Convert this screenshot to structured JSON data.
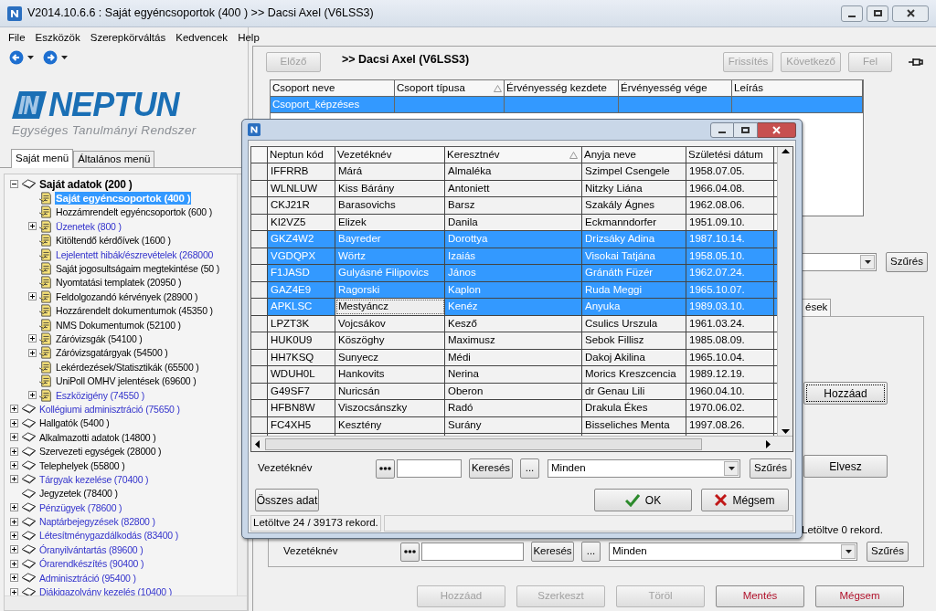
{
  "window": {
    "title": "V2014.10.6.6 : Saját egyéncsoportok (400  )  >> Dacsi Axel (V6LSS3)"
  },
  "menu": [
    "File",
    "Eszközök",
    "Szerepkörváltás",
    "Kedvencek",
    "Help"
  ],
  "logo": {
    "name": "NEPTUN",
    "tagline": "Egységes Tanulmányi Rendszer"
  },
  "left_tabs": [
    {
      "label": "Saját menü",
      "selected": true
    },
    {
      "label": "Általános menü",
      "selected": false
    }
  ],
  "tree": [
    {
      "label": "Saját adatok (200 )",
      "kind": "plain",
      "expanded": true,
      "selected": false,
      "children": [
        {
          "label": "Saját egyéncsoportok (400 )",
          "selected": true
        },
        {
          "label": "Hozzámrendelt egyéncsoportok (600 )",
          "kind": "plain",
          "selected": false
        },
        {
          "label": "Üzenetek (800 )",
          "kind": "link",
          "expanded": false,
          "selected": false
        },
        {
          "label": "Kitöltendő kérdőívek (1600 )",
          "kind": "plain",
          "selected": false
        },
        {
          "label": "Lejelentett hibák/észrevételek (268000",
          "kind": "link",
          "selected": false
        },
        {
          "label": "Saját jogosultságaim megtekintése (50 )",
          "kind": "plain",
          "selected": false
        },
        {
          "label": "Nyomtatási templatek (20950 )",
          "kind": "plain",
          "selected": false
        },
        {
          "label": "Feldolgozandó kérvények (28900 )",
          "kind": "plain",
          "expanded": false,
          "selected": false
        },
        {
          "label": "Hozzárendelt dokumentumok (45350 )",
          "kind": "plain",
          "selected": false
        },
        {
          "label": "NMS Dokumentumok (52100 )",
          "kind": "plain",
          "selected": false
        },
        {
          "label": "Záróvizsgák (54100 )",
          "kind": "plain",
          "expanded": false,
          "selected": false
        },
        {
          "label": "Záróvizsgatárgyak (54500 )",
          "kind": "plain",
          "expanded": false,
          "selected": false
        },
        {
          "label": "Lekérdezések/Statisztikák (65500 )",
          "kind": "plain",
          "selected": false
        },
        {
          "label": "UniPoll OMHV jelentések (69600 )",
          "kind": "plain",
          "selected": false
        },
        {
          "label": "Eszközigény (74550 )",
          "kind": "link",
          "expanded": false,
          "selected": false
        }
      ]
    },
    {
      "label": "Kollégiumi adminisztráció (75650 )",
      "kind": "link",
      "expanded": false,
      "selected": false
    },
    {
      "label": "Hallgatók (5400 )",
      "kind": "plain",
      "expanded": false,
      "selected": false
    },
    {
      "label": "Alkalmazotti adatok (14800 )",
      "kind": "plain",
      "expanded": false,
      "selected": false
    },
    {
      "label": "Szervezeti egységek (28000 )",
      "kind": "plain",
      "expanded": false,
      "selected": false
    },
    {
      "label": "Telephelyek (55800 )",
      "kind": "plain",
      "expanded": false,
      "selected": false
    },
    {
      "label": "Tárgyak kezelése (70400 )",
      "kind": "link",
      "expanded": false,
      "selected": false
    },
    {
      "label": "Jegyzetek (78400 )",
      "kind": "plain",
      "selected": false
    },
    {
      "label": "Pénzügyek (78600 )",
      "kind": "link",
      "expanded": false,
      "selected": false
    },
    {
      "label": "Naptárbejegyzések (82800 )",
      "kind": "link",
      "expanded": false,
      "selected": false
    },
    {
      "label": "Létesítménygazdálkodás (83400 )",
      "kind": "link",
      "expanded": false,
      "selected": false
    },
    {
      "label": "Óranyilvántartás (89600 )",
      "kind": "link",
      "expanded": false,
      "selected": false
    },
    {
      "label": "Órarendkészítés (90400 )",
      "kind": "link",
      "expanded": false,
      "selected": false
    },
    {
      "label": "Adminisztráció (95400 )",
      "kind": "link",
      "expanded": false,
      "selected": false
    },
    {
      "label": "Diákigazolvány kezelés (10400 )",
      "kind": "link",
      "expanded": false,
      "selected": false
    }
  ],
  "record": {
    "prev_button": {
      "label": "Előző",
      "disabled": true
    },
    "title": ">> Dacsi Axel (V6LSS3)",
    "right_buttons": [
      {
        "label": "Frissítés",
        "disabled": true
      },
      {
        "label": "Következő",
        "disabled": true
      },
      {
        "label": "Fel",
        "disabled": true
      }
    ]
  },
  "groups_table": {
    "columns": [
      {
        "label": "Csoport neve",
        "sorted": false
      },
      {
        "label": "Csoport típusa",
        "sorted": true
      },
      {
        "label": "Érvényesség kezdete",
        "sorted": false
      },
      {
        "label": "Érvényesség vége",
        "sorted": false
      },
      {
        "label": "Leírás",
        "sorted": false
      }
    ],
    "rows": [
      {
        "cells": [
          "Csoport_képzéses"
        ],
        "selected": true
      }
    ]
  },
  "upper_filter": {
    "filter_button": "Szűrés"
  },
  "detail_tab": {
    "label": "ések",
    "selected": true
  },
  "side_buttons": [
    {
      "label": "Hozzáad",
      "focused": true
    },
    {
      "label": "Elvesz",
      "focused": false
    }
  ],
  "side_status": "Letöltve 0 rekord.",
  "lower_filter": {
    "label": "Vezetéknév",
    "search_button": "Keresés",
    "more_button": "...",
    "combo": "Minden",
    "filter_button": "Szűrés"
  },
  "bottom_buttons": [
    {
      "label": "Hozzáad",
      "disabled": true,
      "kind": "normal"
    },
    {
      "label": "Szerkeszt",
      "disabled": true,
      "kind": "normal"
    },
    {
      "label": "Töröl",
      "disabled": true,
      "kind": "normal"
    },
    {
      "label": "Mentés",
      "disabled": false,
      "kind": "danger"
    },
    {
      "label": "Mégsem",
      "disabled": false,
      "kind": "danger"
    }
  ],
  "dialog": {
    "columns": [
      {
        "label": "Neptun kód",
        "sorted": false
      },
      {
        "label": "Vezetéknév",
        "sorted": false
      },
      {
        "label": "Keresztnév",
        "sorted": true
      },
      {
        "label": "Anyja neve",
        "sorted": false
      },
      {
        "label": "Születési dátum",
        "sorted": false
      }
    ],
    "rows": [
      {
        "cells": [
          "IFFRRB",
          "Márá",
          "Almaléka",
          "Szimpel Csengele",
          "1958.07.05."
        ],
        "selected": false,
        "focused": false
      },
      {
        "cells": [
          "WLNLUW",
          "Kiss Bárány",
          "Antoniett",
          "Nitzky Liána",
          "1966.04.08."
        ],
        "selected": false,
        "focused": false
      },
      {
        "cells": [
          "CKJ21R",
          "Barasovichs",
          "Barsz",
          "Szakály Ágnes",
          "1962.08.06."
        ],
        "selected": false,
        "focused": false
      },
      {
        "cells": [
          "KI2VZ5",
          "Elizek",
          "Danila",
          "Eckmanndorfer",
          "1951.09.10."
        ],
        "selected": false,
        "focused": false
      },
      {
        "cells": [
          "GKZ4W2",
          "Bayreder",
          "Dorottya",
          "Drizsáky Adina",
          "1987.10.14."
        ],
        "selected": true,
        "focused": false
      },
      {
        "cells": [
          "VGDQPX",
          "Wörtz",
          "Izaiás",
          "Visokai Tatjána",
          "1958.05.10."
        ],
        "selected": true,
        "focused": false
      },
      {
        "cells": [
          "F1JASD",
          "Gulyásné Filipovics",
          "János",
          "Gránáth Füzér",
          "1962.07.24."
        ],
        "selected": true,
        "focused": false
      },
      {
        "cells": [
          "GAZ4E9",
          "Ragorski",
          "Kaplon",
          "Ruda Meggi",
          "1965.10.07."
        ],
        "selected": true,
        "focused": false
      },
      {
        "cells": [
          "APKLSC",
          "Mestyáncz",
          "Kenéz",
          "Anyuka",
          "1989.03.10."
        ],
        "selected": true,
        "focused": true
      },
      {
        "cells": [
          "LPZT3K",
          "Vojcsákov",
          "Kesző",
          "Csulics Urszula",
          "1961.03.24."
        ],
        "selected": false,
        "focused": false
      },
      {
        "cells": [
          "HUK0U9",
          "Köszöghy",
          "Maximusz",
          "Sebok Fillisz",
          "1985.08.09."
        ],
        "selected": false,
        "focused": false
      },
      {
        "cells": [
          "HH7KSQ",
          "Sunyecz",
          "Médi",
          "Dakoj Akilina",
          "1965.10.04."
        ],
        "selected": false,
        "focused": false
      },
      {
        "cells": [
          "WDUH0L",
          "Hankovits",
          "Nerina",
          "Morics Kreszcencia",
          "1989.12.19."
        ],
        "selected": false,
        "focused": false
      },
      {
        "cells": [
          "G49SF7",
          "Nuricsán",
          "Oberon",
          "dr Genau Lili",
          "1960.04.10."
        ],
        "selected": false,
        "focused": false
      },
      {
        "cells": [
          "HFBN8W",
          "Viszocsánszky",
          "Radó",
          "Drakula Ékes",
          "1970.06.02."
        ],
        "selected": false,
        "focused": false
      },
      {
        "cells": [
          "FC4XH5",
          "Kesztény",
          "Surány",
          "Bisseliches Menta",
          "1997.08.26."
        ],
        "selected": false,
        "focused": false
      }
    ],
    "filter": {
      "label": "Vezetéknév",
      "search_button": "Keresés",
      "more_button": "...",
      "combo": "Minden",
      "filter_button": "Szűrés"
    },
    "all_button": "Összes adat",
    "ok_button": "OK",
    "cancel_button": "Mégsem",
    "status": "Letöltve 24 / 39173 rekord."
  }
}
